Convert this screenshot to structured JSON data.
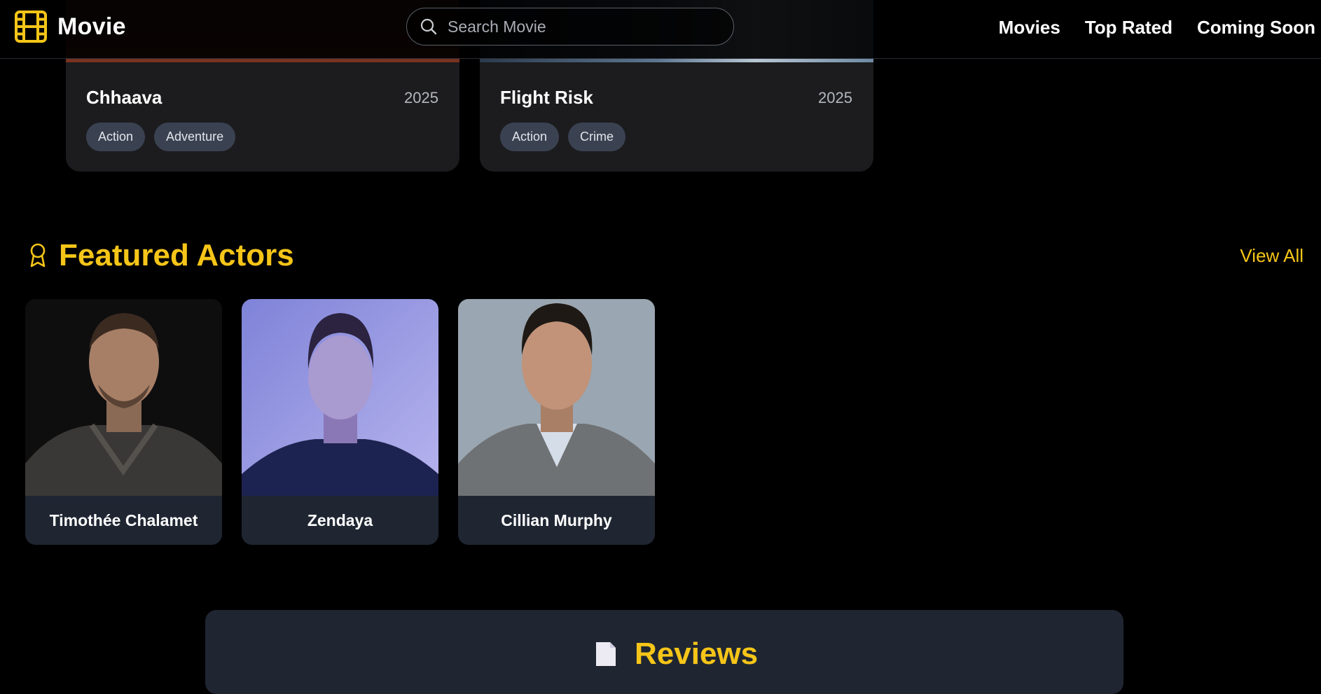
{
  "nav": {
    "brand": "Movie",
    "search_placeholder": "Search Movie",
    "links": [
      "Movies",
      "Top Rated",
      "Coming Soon"
    ]
  },
  "movies": [
    {
      "title": "Chhaava",
      "year": "2025",
      "genres": [
        "Action",
        "Adventure"
      ]
    },
    {
      "title": "Flight Risk",
      "year": "2025",
      "genres": [
        "Action",
        "Crime"
      ]
    }
  ],
  "featured_actors": {
    "title": "Featured Actors",
    "view_all": "View All",
    "actors": [
      {
        "name": "Timothée Chalamet"
      },
      {
        "name": "Zendaya"
      },
      {
        "name": "Cillian Murphy"
      }
    ]
  },
  "reviews": {
    "title": "Reviews"
  },
  "colors": {
    "accent": "#f5c518",
    "background": "#000000",
    "card": "#1c1c1e",
    "actor_card": "#1f2632",
    "tag": "#3a4252"
  },
  "icons": {
    "brand": "film-icon",
    "search": "search-icon",
    "section": "award-icon",
    "reviews": "document-icon"
  }
}
